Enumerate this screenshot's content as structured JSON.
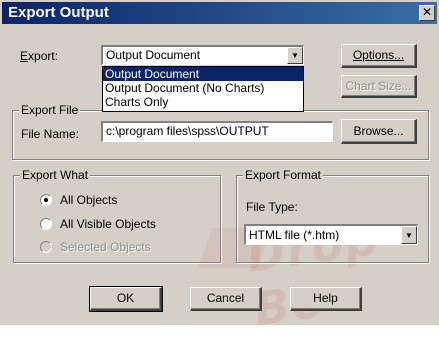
{
  "window": {
    "title": "Export Output",
    "close_glyph": "✕"
  },
  "export": {
    "label": "Export:",
    "selected": "Output Document",
    "options": [
      "Output Document",
      "Output Document (No Charts)",
      "Charts Only"
    ]
  },
  "buttons": {
    "options": "Options...",
    "chart_size": "Chart Size...",
    "browse": "Browse...",
    "ok": "OK",
    "cancel": "Cancel",
    "help": "Help"
  },
  "export_file": {
    "group_title": "Export File",
    "file_name_label": "File Name:",
    "file_name_value": "c:\\program files\\spss\\OUTPUT"
  },
  "export_what": {
    "group_title": "Export What",
    "options": [
      {
        "label": "All Objects",
        "selected": true,
        "enabled": true
      },
      {
        "label": "All Visible Objects",
        "selected": false,
        "enabled": true
      },
      {
        "label": "Selected Objects",
        "selected": false,
        "enabled": false
      }
    ]
  },
  "export_format": {
    "group_title": "Export Format",
    "file_type_label": "File Type:",
    "file_type_value": "HTML file (*.htm)"
  },
  "watermark": "Drop Bo",
  "colors": {
    "titlebar_start": "#0a246a",
    "titlebar_end": "#3a6ea5",
    "face": "#d4d0c8"
  }
}
